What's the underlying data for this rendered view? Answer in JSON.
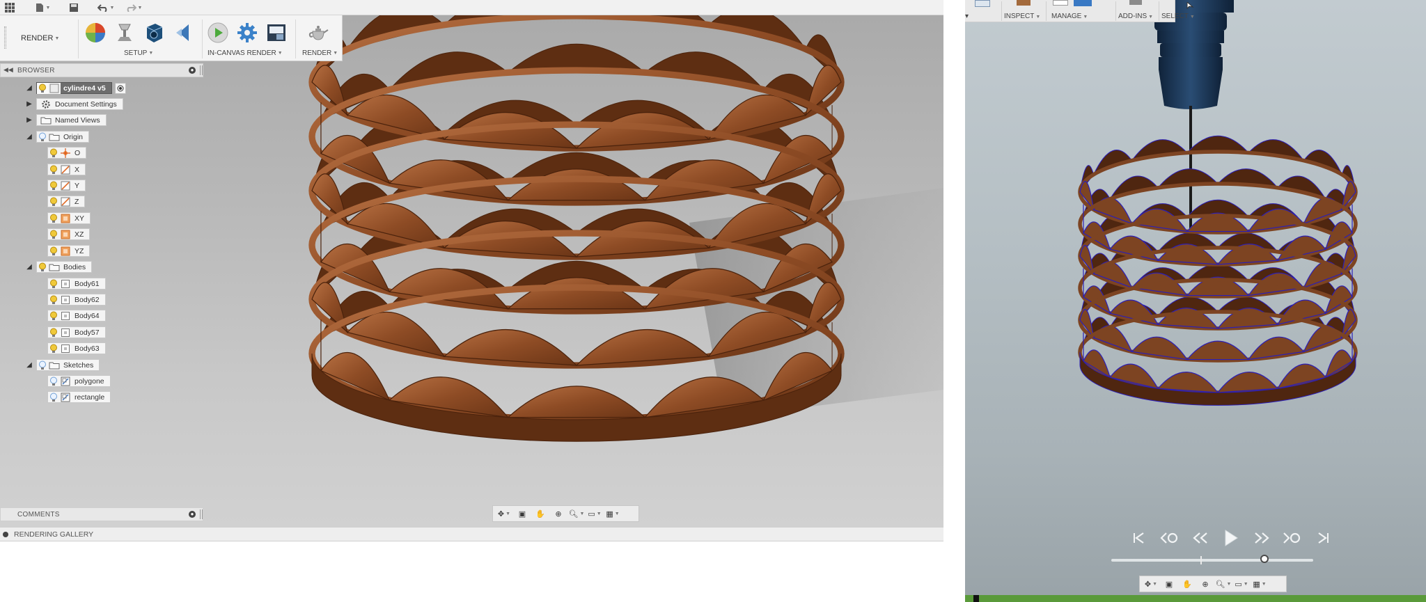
{
  "ribbon": {
    "workspace": "RENDER",
    "groups": [
      {
        "label": "SETUP"
      },
      {
        "label": "IN-CANVAS RENDER"
      },
      {
        "label": "RENDER"
      }
    ]
  },
  "browser": {
    "title": "BROWSER",
    "root": "cylindre4 v5",
    "items": [
      {
        "label": "Document Settings",
        "icon": "gear-icon"
      },
      {
        "label": "Named Views",
        "icon": "folder-icon"
      },
      {
        "label": "Origin",
        "icon": "folder-icon"
      },
      {
        "label": "O",
        "icon": "origin-point-icon"
      },
      {
        "label": "X",
        "icon": "axis-icon"
      },
      {
        "label": "Y",
        "icon": "axis-icon"
      },
      {
        "label": "Z",
        "icon": "axis-icon"
      },
      {
        "label": "XY",
        "icon": "plane-icon"
      },
      {
        "label": "XZ",
        "icon": "plane-icon"
      },
      {
        "label": "YZ",
        "icon": "plane-icon"
      },
      {
        "label": "Bodies",
        "icon": "folder-icon"
      },
      {
        "label": "Body61",
        "icon": "body-icon"
      },
      {
        "label": "Body62",
        "icon": "body-icon"
      },
      {
        "label": "Body64",
        "icon": "body-icon"
      },
      {
        "label": "Body57",
        "icon": "body-icon"
      },
      {
        "label": "Body63",
        "icon": "body-icon"
      },
      {
        "label": "Sketches",
        "icon": "folder-icon"
      },
      {
        "label": "polygone",
        "icon": "sketch-icon"
      },
      {
        "label": "rectangle",
        "icon": "sketch-icon"
      }
    ]
  },
  "comments": {
    "title": "COMMENTS"
  },
  "rendering_gallery": {
    "title": "RENDERING GALLERY"
  },
  "right_menu": {
    "items": [
      {
        "label": "INSPECT"
      },
      {
        "label": "MANAGE"
      },
      {
        "label": "ADD-INS"
      },
      {
        "label": "SELECT"
      }
    ]
  },
  "playback": {
    "progress": 0.76
  },
  "colors": {
    "wood": "#8a4a24",
    "wood_light": "#b36a3c",
    "wood_dark": "#5a2c12",
    "viewport_left": "#b7b7b7",
    "viewport_right": "#b3bdc2",
    "tool_head": "#1f3a58",
    "status_bar": "#5a9a3a"
  }
}
